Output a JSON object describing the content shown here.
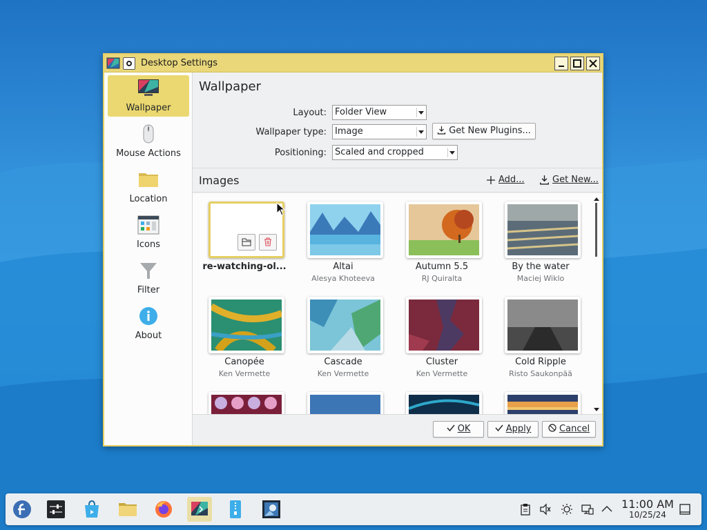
{
  "window": {
    "title": "Desktop Settings",
    "minimize": "_",
    "maximize": "□",
    "close": "✕"
  },
  "sidebar": {
    "items": [
      {
        "label": "Wallpaper",
        "icon": "monitor-icon",
        "active": true
      },
      {
        "label": "Mouse Actions",
        "icon": "mouse-icon",
        "active": false
      },
      {
        "label": "Location",
        "icon": "folder-icon",
        "active": false
      },
      {
        "label": "Icons",
        "icon": "icons-grid-icon",
        "active": false
      },
      {
        "label": "Filter",
        "icon": "filter-icon",
        "active": false
      },
      {
        "label": "About",
        "icon": "info-icon",
        "active": false
      }
    ]
  },
  "page": {
    "title": "Wallpaper",
    "layout_label": "Layout:",
    "layout_value": "Folder View",
    "type_label": "Wallpaper type:",
    "type_value": "Image",
    "get_plugins": "Get New Plugins...",
    "positioning_label": "Positioning:",
    "positioning_value": "Scaled and cropped"
  },
  "images": {
    "title": "Images",
    "add_label": "Add...",
    "get_new_label": "Get New...",
    "items": [
      {
        "name": "re-watching-ol...",
        "author": "",
        "selected": true
      },
      {
        "name": "Altai",
        "author": "Alesya Khoteeva"
      },
      {
        "name": "Autumn 5.5",
        "author": "RJ Quiralta"
      },
      {
        "name": "By the water",
        "author": "Maciej Wiklo"
      },
      {
        "name": "Canopée",
        "author": "Ken Vermette"
      },
      {
        "name": "Cascade",
        "author": "Ken Vermette"
      },
      {
        "name": "Cluster",
        "author": "Ken Vermette"
      },
      {
        "name": "Cold Ripple",
        "author": "Risto Saukonpää"
      },
      {
        "name": "",
        "author": ""
      },
      {
        "name": "",
        "author": ""
      },
      {
        "name": "",
        "author": ""
      },
      {
        "name": "",
        "author": ""
      }
    ]
  },
  "buttons": {
    "ok": "OK",
    "apply": "Apply",
    "cancel": "Cancel"
  },
  "taskbar": {
    "clock_time": "11:00 AM",
    "clock_date": "10/25/24",
    "apps": [
      "fedora-launcher-icon",
      "settings-icon",
      "discover-icon",
      "file-manager-icon",
      "firefox-icon",
      "desktop-settings-icon",
      "archive-icon",
      "screenshot-icon"
    ],
    "tray": [
      "clipboard-icon",
      "volume-muted-icon",
      "brightness-icon",
      "network-icon",
      "tray-expand-icon",
      "show-desktop-icon"
    ]
  },
  "colors": {
    "accent": "#e9d77a",
    "selection": "#ebd870",
    "desktop": "#2b8fd6"
  }
}
